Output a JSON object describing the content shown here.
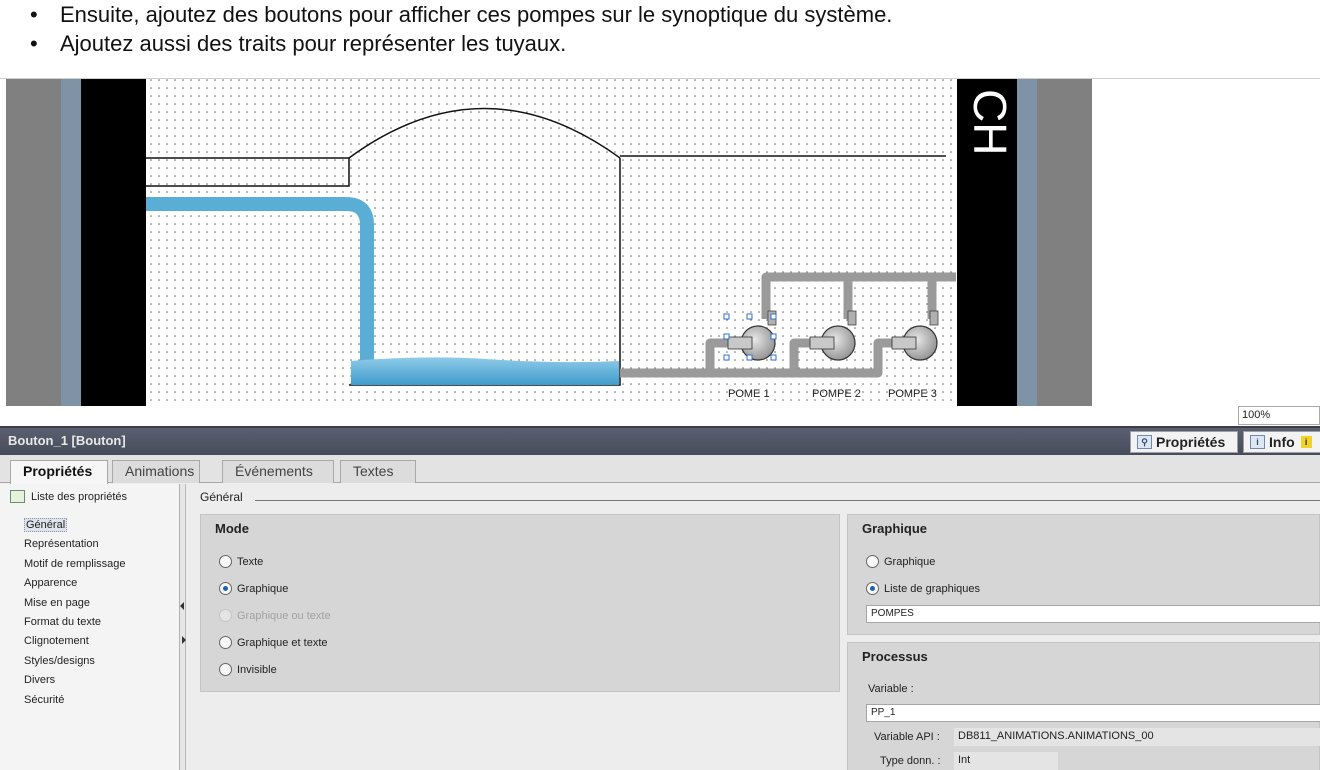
{
  "slide": {
    "bullets": [
      "Ensuite, ajoutez des boutons pour afficher ces pompes sur le synoptique du système.",
      "Ajoutez aussi des traits pour représenter les tuyaux."
    ],
    "bullet_glyph": "•"
  },
  "canvas": {
    "pump_labels": [
      "POME 1",
      "POMPE 2",
      "POMPE 3"
    ],
    "side_text": "CH",
    "zoom_value": "100%",
    "colors": {
      "water": "#5aaed6",
      "pipe_gray": "#999999",
      "frame_dark": "#000000",
      "frame_blue": "#7f93a6"
    }
  },
  "inspector": {
    "title": "Bouton_1 [Bouton]",
    "header_tabs": {
      "properties": "Propriétés",
      "info": "Info"
    },
    "tabs": [
      "Propriétés",
      "Animations",
      "Événements",
      "Textes"
    ],
    "active_tab": "Propriétés",
    "property_list": {
      "header": "Liste des propriétés",
      "items": [
        "Général",
        "Représentation",
        "Motif de remplissage",
        "Apparence",
        "Mise en page",
        "Format du texte",
        "Clignotement",
        "Styles/designs",
        "Divers",
        "Sécurité"
      ],
      "selected": "Général"
    },
    "section_title": "Général",
    "mode": {
      "title": "Mode",
      "options": [
        {
          "label": "Texte",
          "selected": false,
          "enabled": true
        },
        {
          "label": "Graphique",
          "selected": true,
          "enabled": true
        },
        {
          "label": "Graphique ou texte",
          "selected": false,
          "enabled": false
        },
        {
          "label": "Graphique et texte",
          "selected": false,
          "enabled": true
        },
        {
          "label": "Invisible",
          "selected": false,
          "enabled": true
        }
      ]
    },
    "graphic": {
      "title": "Graphique",
      "options": [
        {
          "label": "Graphique",
          "selected": false
        },
        {
          "label": "Liste de graphiques",
          "selected": true
        }
      ],
      "list_value": "POMPES"
    },
    "process": {
      "title": "Processus",
      "variable_label": "Variable :",
      "variable_value": "PP_1",
      "api_label": "Variable API :",
      "api_value": "DB811_ANIMATIONS.ANIMATIONS_00",
      "type_label": "Type donn. :",
      "type_value": "Int"
    }
  }
}
